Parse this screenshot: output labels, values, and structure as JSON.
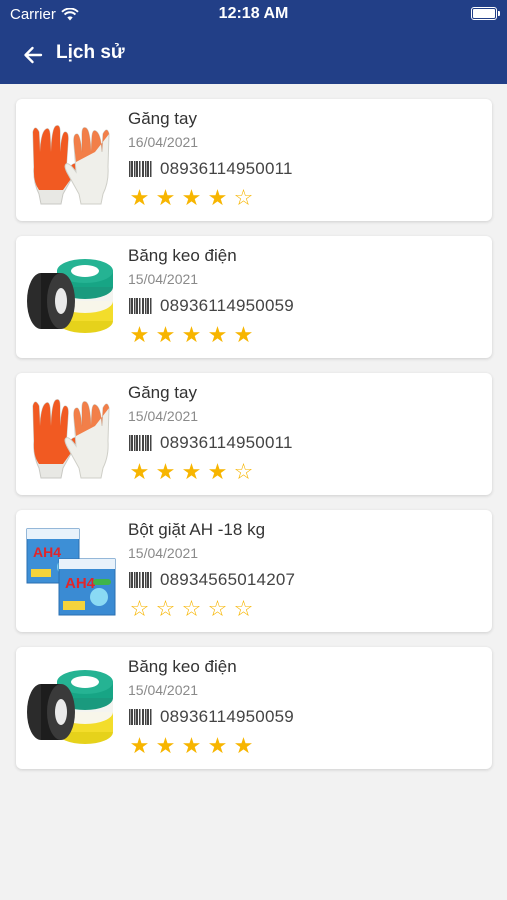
{
  "status_bar": {
    "carrier": "Carrier",
    "time": "12:18 AM"
  },
  "header": {
    "title": "Lịch sử"
  },
  "colors": {
    "header_bg": "#223f87",
    "star": "#f7b500"
  },
  "icons": {
    "back": "back-arrow-icon",
    "barcode": "barcode-icon",
    "wifi": "wifi-icon",
    "battery": "battery-icon"
  },
  "history": [
    {
      "name": "Găng tay",
      "date": "16/04/2021",
      "code": "08936114950011",
      "rating": 4,
      "image": "gloves"
    },
    {
      "name": "Băng keo điện",
      "date": "15/04/2021",
      "code": "08936114950059",
      "rating": 5,
      "image": "tape"
    },
    {
      "name": "Găng tay",
      "date": "15/04/2021",
      "code": "08936114950011",
      "rating": 4,
      "image": "gloves"
    },
    {
      "name": "Bột giặt AH -18 kg",
      "date": "15/04/2021",
      "code": "08934565014207",
      "rating": 0,
      "image": "detergent"
    },
    {
      "name": "Băng keo điện",
      "date": "15/04/2021",
      "code": "08936114950059",
      "rating": 5,
      "image": "tape"
    }
  ]
}
